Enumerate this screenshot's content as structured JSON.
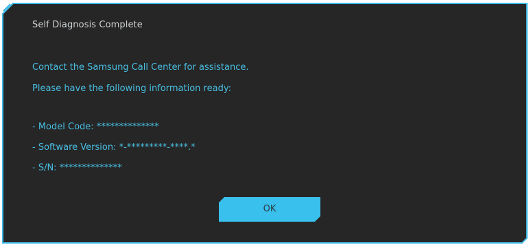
{
  "dialog": {
    "title": "Self Diagnosis Complete",
    "message_line_1": "Contact the Samsung Call Center for assistance.",
    "message_line_2": "Please have the following information ready:",
    "model_code": "- Model Code: **************",
    "software_version": "- Software Version: *-*********-****.*",
    "serial_number": "- S/N: **************",
    "ok_label": "OK"
  },
  "colors": {
    "background": "#262626",
    "border": "#3db8e6",
    "text_accent": "#48bfe3",
    "title_text": "#cfd3d6",
    "button": "#39c0ec"
  }
}
